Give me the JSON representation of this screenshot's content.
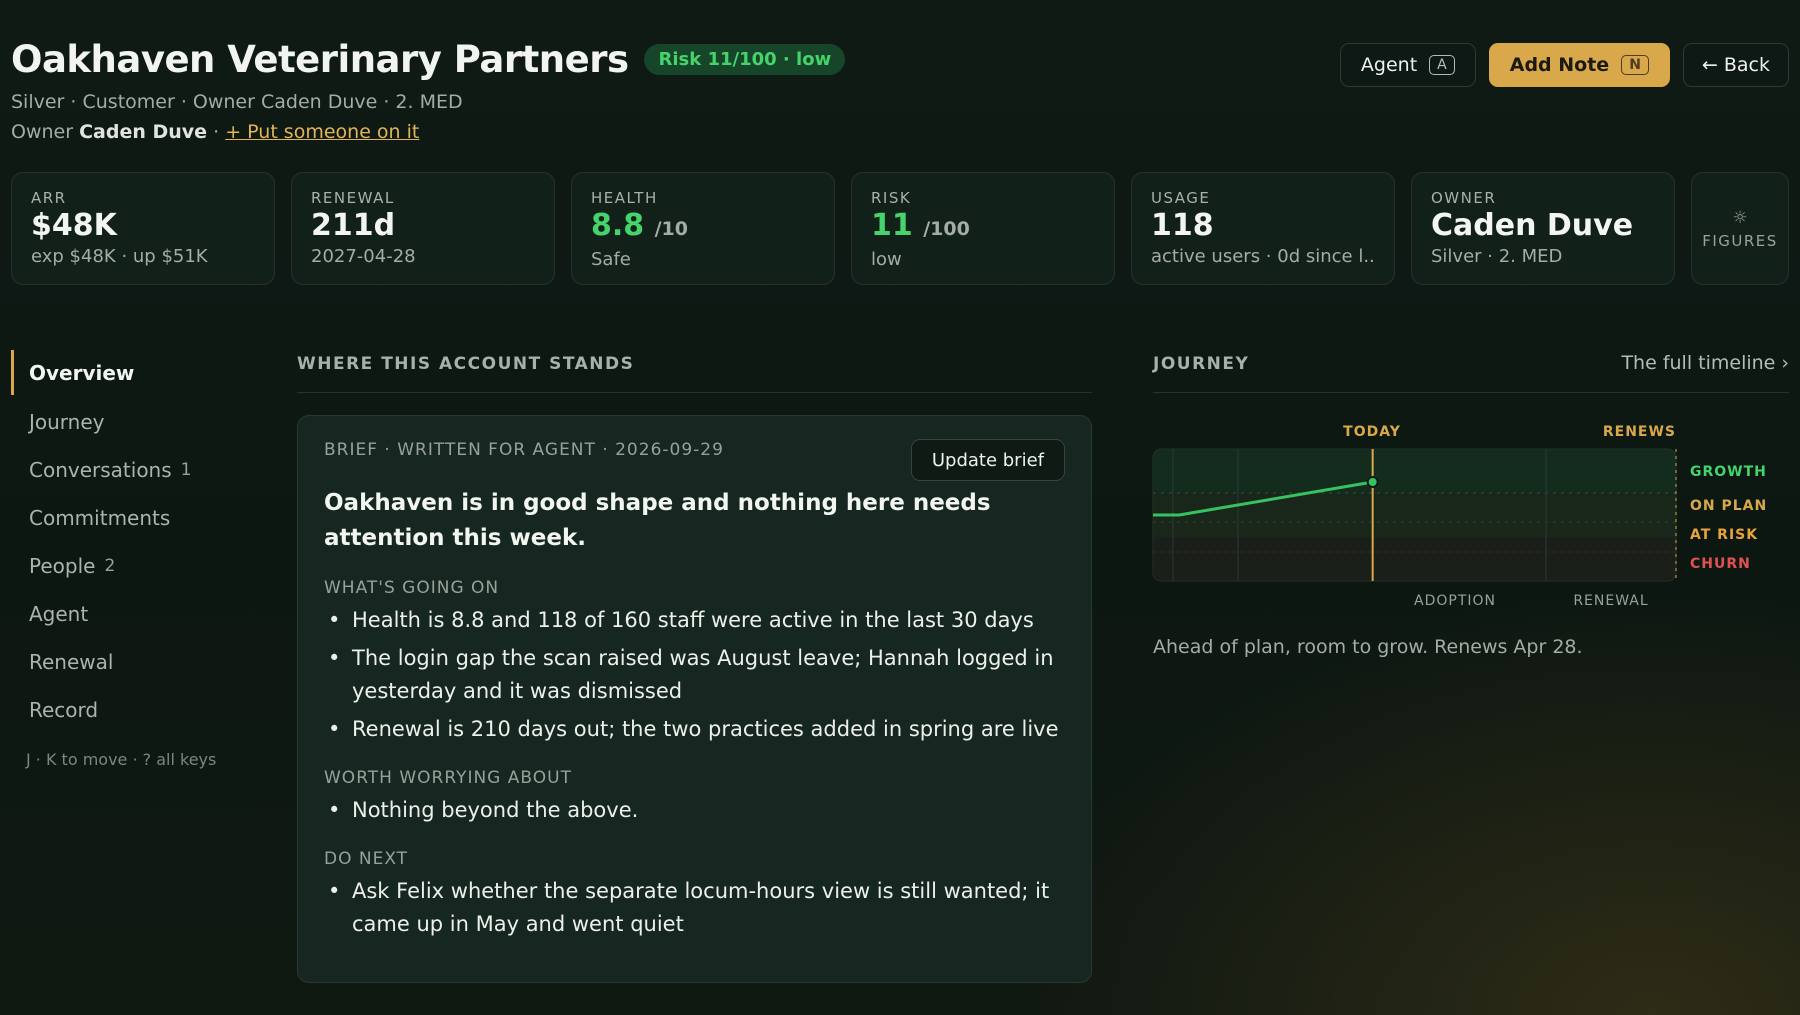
{
  "account": {
    "name": "Oakhaven Veterinary Partners",
    "risk_pill": "Risk 11/100 · low",
    "subline": "Silver · Customer · Owner Caden Duve · 2. MED",
    "owner_prefix": "Owner",
    "owner_name": "Caden Duve",
    "owner_sep": " · ",
    "assign_link": "+ Put someone on it"
  },
  "actions": {
    "agent_label": "Agent",
    "agent_key": "A",
    "add_note_label": "Add Note",
    "add_note_key": "N",
    "back_label": "← Back"
  },
  "metrics": [
    {
      "label": "ARR",
      "value": "$48K",
      "suffix": "",
      "sub": "exp $48K · up $51K"
    },
    {
      "label": "RENEWAL",
      "value": "211d",
      "suffix": "",
      "sub": "2027-04-28"
    },
    {
      "label": "HEALTH",
      "value": "8.8",
      "suffix": "/10",
      "sub": "Safe"
    },
    {
      "label": "RISK",
      "value": "11",
      "suffix": "/100",
      "sub": "low"
    },
    {
      "label": "USAGE",
      "value": "118",
      "suffix": "",
      "sub": "active users · 0d since l..."
    },
    {
      "label": "OWNER",
      "value": "Caden Duve",
      "suffix": "",
      "sub": "Silver · 2. MED"
    }
  ],
  "figures": {
    "icon": "sun-icon",
    "label": "FIGURES"
  },
  "nav": {
    "items": [
      {
        "label": "Overview",
        "count": ""
      },
      {
        "label": "Journey",
        "count": ""
      },
      {
        "label": "Conversations",
        "count": "1"
      },
      {
        "label": "Commitments",
        "count": ""
      },
      {
        "label": "People",
        "count": "2"
      },
      {
        "label": "Agent",
        "count": ""
      },
      {
        "label": "Renewal",
        "count": ""
      },
      {
        "label": "Record",
        "count": ""
      }
    ],
    "hint": "J · K to move · ? all keys"
  },
  "stands": {
    "heading": "WHERE THIS ACCOUNT STANDS",
    "brief_meta": "BRIEF · WRITTEN FOR AGENT · 2026-09-29",
    "update_label": "Update brief",
    "headline": "Oakhaven is in good shape and nothing here needs attention this week.",
    "sections": [
      {
        "heading": "WHAT'S GOING ON",
        "items": [
          "Health is 8.8 and 118 of 160 staff were active in the last 30 days",
          "The login gap the scan raised was August leave; Hannah logged in yesterday and it was dismissed",
          "Renewal is 210 days out; the two practices added in spring are live"
        ]
      },
      {
        "heading": "WORTH WORRYING ABOUT",
        "items": [
          "Nothing beyond the above."
        ]
      },
      {
        "heading": "DO NEXT",
        "items": [
          "Ask Felix whether the separate locum-hours view is still wanted; it came up in May and went quiet"
        ]
      }
    ]
  },
  "journey": {
    "heading": "JOURNEY",
    "link": "The full timeline ›",
    "caption": "Ahead of plan, room to grow. Renews Apr 28.",
    "chart_data": {
      "type": "line",
      "markers": {
        "today": "TODAY",
        "renews": "RENEWS"
      },
      "bands": [
        "GROWTH",
        "ON PLAN",
        "AT RISK",
        "CHURN"
      ],
      "phases": [
        "ADOPTION",
        "RENEWAL"
      ],
      "x": [
        0,
        0.05,
        0.42
      ],
      "y": [
        0.5,
        0.5,
        0.75
      ],
      "xlim": [
        0,
        1
      ],
      "ylim": [
        0,
        1
      ],
      "today_x": 0.42,
      "renews_x": 1.0,
      "colors": {
        "line": "#36c263",
        "today": "#d9a84b",
        "growth": "#45d36b",
        "on_plan": "#d9a84b",
        "at_risk": "#e8a33b",
        "churn": "#e05252"
      }
    }
  }
}
